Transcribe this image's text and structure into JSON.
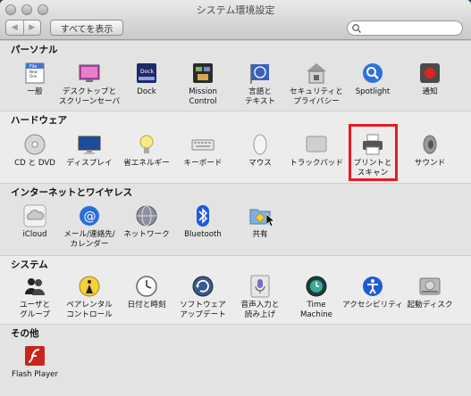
{
  "window": {
    "title": "システム環境設定"
  },
  "toolbar": {
    "back": "◀",
    "forward": "▶",
    "show_all": "すべてを表示",
    "search_placeholder": "",
    "search_value": ""
  },
  "sections": {
    "personal": {
      "title": "パーソナル",
      "items": [
        "一般",
        "デスクトップと\nスクリーンセーバ",
        "Dock",
        "Mission\nControl",
        "言語と\nテキスト",
        "セキュリティと\nプライバシー",
        "Spotlight",
        "通知"
      ],
      "icon_labels": {
        "file": "File",
        "new": "New",
        "one": "One",
        "dock": "Dock"
      }
    },
    "hardware": {
      "title": "ハードウェア",
      "items": [
        "CD と DVD",
        "ディスプレイ",
        "省エネルギー",
        "キーボード",
        "マウス",
        "トラックパッド",
        "プリントと\nスキャン",
        "サウンド"
      ]
    },
    "internet": {
      "title": "インターネットとワイヤレス",
      "items": [
        "iCloud",
        "メール/連絡先/\nカレンダー",
        "ネットワーク",
        "Bluetooth",
        "共有"
      ]
    },
    "system": {
      "title": "システム",
      "items": [
        "ユーザと\nグループ",
        "ペアレンタル\nコントロール",
        "日付と時刻",
        "ソフトウェア\nアップデート",
        "音声入力と\n読み上げ",
        "Time\nMachine",
        "アクセシビリティ",
        "起動ディスク"
      ]
    },
    "other": {
      "title": "その他",
      "items": [
        "Flash Player"
      ]
    }
  },
  "colors": {
    "highlight": "#e31b24",
    "spotlight": "#2f6fe0",
    "mail": "#2a6fd6",
    "bluetooth": "#1f5bd8",
    "flash": "#c8261c"
  }
}
